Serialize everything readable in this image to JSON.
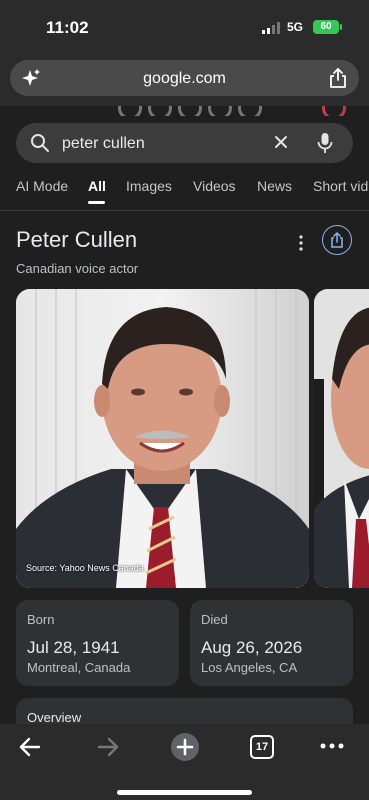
{
  "status": {
    "time": "11:02",
    "network": "5G",
    "battery": "60"
  },
  "browser": {
    "url": "google.com"
  },
  "search": {
    "query": "peter cullen"
  },
  "tabs": [
    "AI Mode",
    "All",
    "Images",
    "Videos",
    "News",
    "Short vid"
  ],
  "active_tab": "All",
  "entity": {
    "name": "Peter Cullen",
    "description": "Canadian voice actor"
  },
  "image": {
    "caption": "Source: Yahoo News Canada"
  },
  "facts": {
    "born": {
      "label": "Born",
      "date": "Jul 28, 1941",
      "place": "Montreal, Canada"
    },
    "died": {
      "label": "Died",
      "date": "Aug 26, 2026",
      "place": "Los Angeles, CA"
    }
  },
  "overview": {
    "label": "Overview"
  },
  "toolbar": {
    "tab_count": "17"
  },
  "colors": {
    "accent": "#8ab4f8",
    "battery": "#35c759",
    "background": "#1f1f1f",
    "card": "#303134"
  }
}
